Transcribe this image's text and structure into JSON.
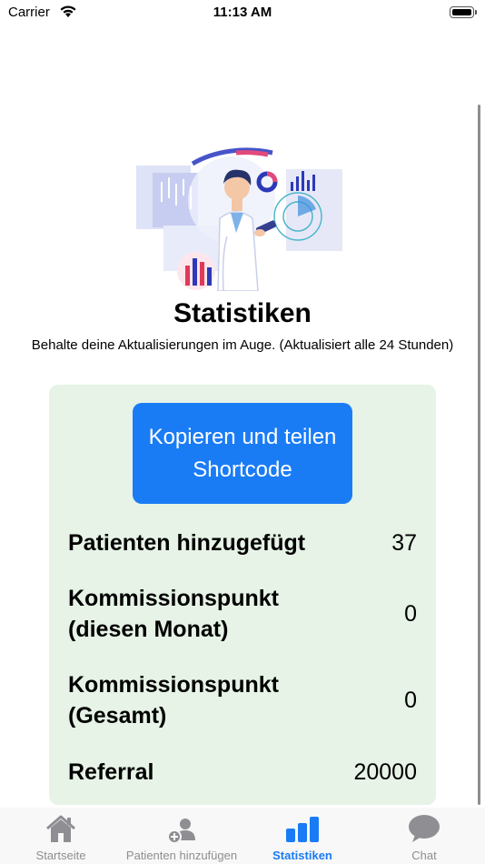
{
  "status_bar": {
    "carrier": "Carrier",
    "time": "11:13 AM"
  },
  "header": {
    "title": "Statistiken",
    "subtitle": "Behalte deine Aktualisierungen im Auge. (Aktualisiert alle 24 Stunden)"
  },
  "card": {
    "share_button_label": "Kopieren und teilen Shortcode",
    "stats": [
      {
        "label": "Patienten hinzugefügt",
        "value": "37"
      },
      {
        "label": "Kommissionspunkt (diesen Monat)",
        "value": "0"
      },
      {
        "label": "Kommissionspunkt (Gesamt)",
        "value": "0"
      },
      {
        "label": "Referral",
        "value": "20000"
      }
    ]
  },
  "tab_bar": {
    "items": [
      {
        "label": "Startseite",
        "icon": "home-icon"
      },
      {
        "label": "Patienten hinzufügen",
        "icon": "add-patient-icon"
      },
      {
        "label": "Statistiken",
        "icon": "bar-chart-icon"
      },
      {
        "label": "Chat",
        "icon": "chat-bubble-icon"
      }
    ],
    "active_index": 2
  },
  "colors": {
    "accent": "#1a7cf5",
    "card_background": "#e6f3e6",
    "inactive_tab": "#8e8e93"
  }
}
